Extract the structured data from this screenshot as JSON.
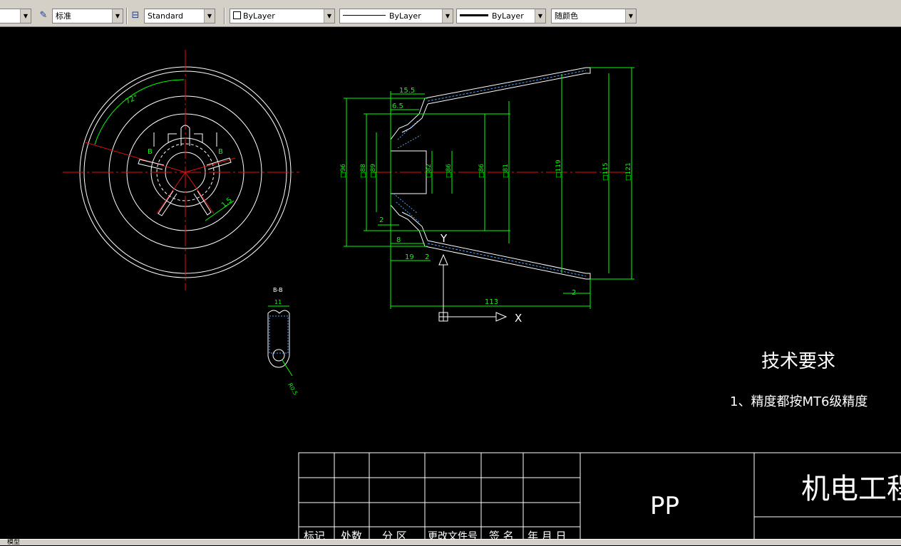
{
  "toolbar": {
    "text_style": "标准",
    "dim_style": "Standard",
    "layer": "ByLayer",
    "linetype": "ByLayer",
    "lineweight": "ByLayer",
    "color": "随颜色"
  },
  "drawing": {
    "angle_label": "72°",
    "section_markers": [
      "B",
      "B"
    ],
    "front_slot_dim": "1.5",
    "section_title": "B-B",
    "section_width_dim": "11",
    "section_radius_dim": "R0.5",
    "dims_top": [
      "15.5",
      "6.5"
    ],
    "dims_left": [
      "□96",
      "□88",
      "□89",
      "□82",
      "□86"
    ],
    "dims_right": [
      "□86",
      "□81",
      "□119",
      "□115",
      "□121"
    ],
    "dims_bottom": [
      "2",
      "8",
      "19",
      "2",
      "113",
      "2"
    ],
    "ucs_x": "X",
    "ucs_y": "Y",
    "tech_title": "技术要求",
    "tech_note": "1、精度都按MT6级精度",
    "material": "PP",
    "company": "机电工程学",
    "table_headers": [
      "标记",
      "处数",
      "分 区",
      "更改文件号",
      "签 名",
      "年 月 日"
    ]
  },
  "status": {
    "tab_model": "模型"
  }
}
